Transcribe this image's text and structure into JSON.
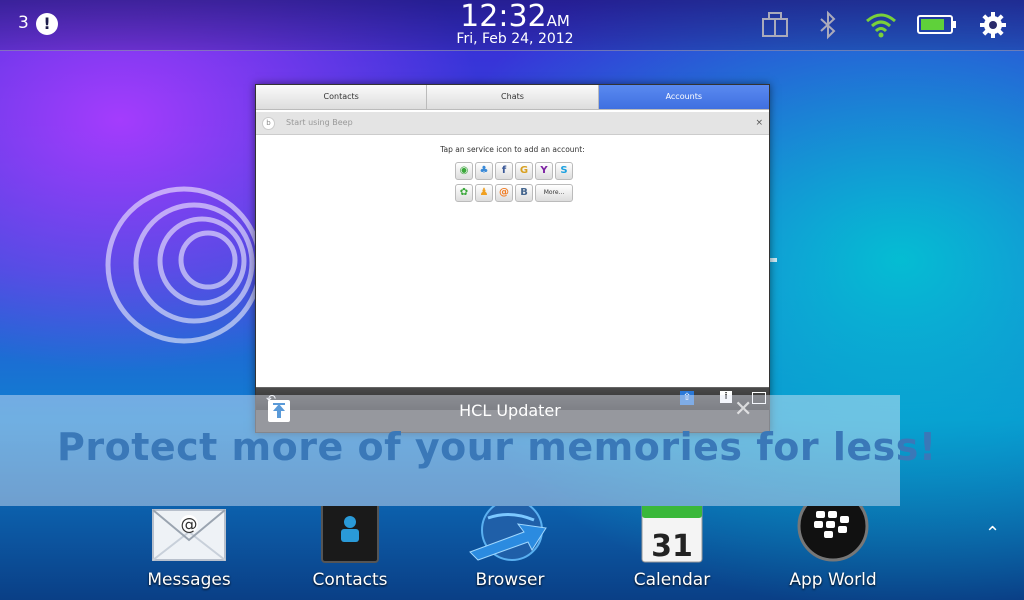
{
  "statusbar": {
    "notification_count": "3",
    "time": "12:32",
    "ampm": "AM",
    "date": "Fri, Feb 24, 2012",
    "icons": [
      "multitask-icon",
      "bluetooth-icon",
      "wifi-icon",
      "battery-icon",
      "settings-icon"
    ]
  },
  "app_window": {
    "tabs": [
      "Contacts",
      "Chats",
      "Accounts"
    ],
    "active_tab": "Accounts",
    "beep_text": "Start using Beep",
    "beep_close": "×",
    "instruction": "Tap an service icon to add an account:",
    "services_row1": [
      "WhatsApp",
      "MSN",
      "Facebook",
      "Google",
      "Yahoo",
      "Skype"
    ],
    "services_row2": [
      "ICQ",
      "AIM",
      "Mail.ru",
      "VKontakte"
    ],
    "more_label": "More..."
  },
  "updater": {
    "title": "HCL Updater",
    "close": "✕"
  },
  "promo_text": "Protect more of your memories for less!",
  "dock": {
    "items": [
      {
        "label": "Messages",
        "icon": "messages-icon"
      },
      {
        "label": "Contacts",
        "icon": "contacts-icon"
      },
      {
        "label": "Browser",
        "icon": "browser-icon"
      },
      {
        "label": "Calendar",
        "icon": "calendar-icon",
        "day": "31"
      },
      {
        "label": "App World",
        "icon": "app-world-icon"
      }
    ],
    "expand_glyph": "⌃"
  },
  "colors": {
    "accent_tab": "#4a7ce8",
    "promo_text": "#3a78b8",
    "wifi": "#7ad13a",
    "battery": "#5fd13a"
  }
}
